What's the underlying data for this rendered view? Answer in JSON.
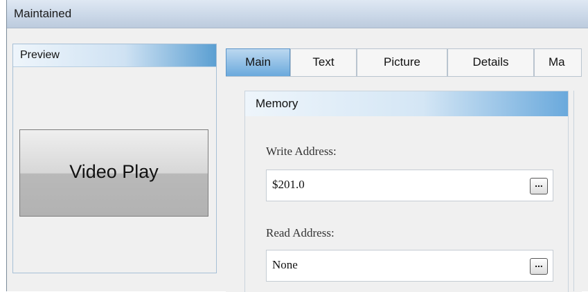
{
  "window": {
    "title": "Maintained"
  },
  "preview": {
    "header": "Preview",
    "button_label": "Video Play"
  },
  "tabs": [
    {
      "label": "Main",
      "active": true
    },
    {
      "label": "Text",
      "active": false
    },
    {
      "label": "Picture",
      "active": false
    },
    {
      "label": "Details",
      "active": false
    },
    {
      "label": "Ma",
      "active": false
    }
  ],
  "memory": {
    "header": "Memory",
    "write_address": {
      "label": "Write Address:",
      "value": "$201.0",
      "browse_label": "..."
    },
    "read_address": {
      "label": "Read Address:",
      "value": "None",
      "browse_label": "..."
    }
  },
  "colors": {
    "tab_active": "#6aa9dc",
    "header_accent": "#5b9fd2",
    "titlebar": "#cbd8e8"
  }
}
